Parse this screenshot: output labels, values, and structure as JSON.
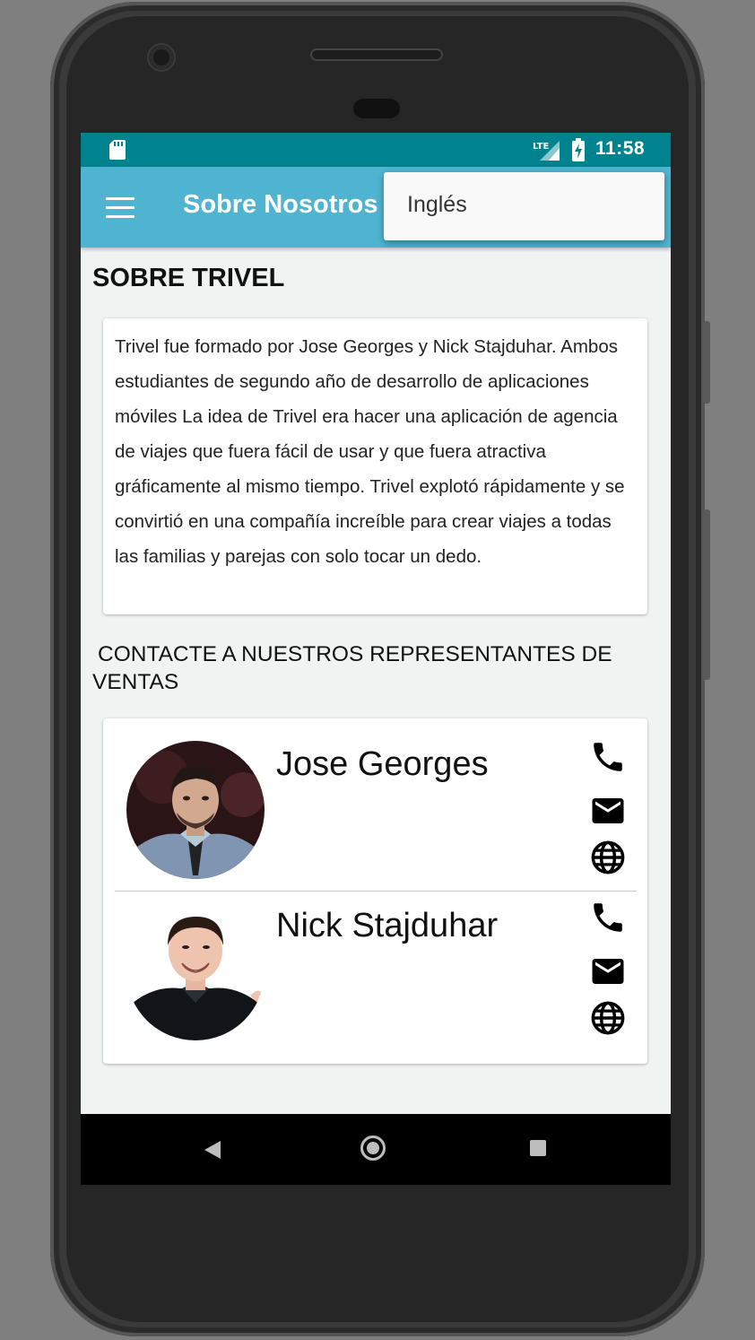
{
  "status_bar": {
    "time": "11:58",
    "network": "LTE",
    "icons": [
      "sd-card-icon",
      "lte-signal-icon",
      "battery-charging-icon"
    ]
  },
  "app_bar": {
    "title": "Sobre Nosotros",
    "menu_icon": "hamburger-menu-icon"
  },
  "dropdown_menu": {
    "items": [
      {
        "label": "Inglés"
      }
    ]
  },
  "about": {
    "heading": "SOBRE TRIVEL",
    "body": "Trivel fue formado por Jose Georges y Nick Stajduhar. Ambos estudiantes de segundo año de desarrollo de aplicaciones móviles La idea de Trivel era hacer una aplicación de agencia de viajes que fuera fácil de usar y que fuera atractiva gráficamente al mismo tiempo. Trivel explotó rápidamente y se convirtió en una compañía increíble para crear viajes a todas las familias y parejas con solo tocar un dedo."
  },
  "contacts": {
    "heading": "CONTACTE A NUESTROS REPRESENTANTES DE VENTAS",
    "representatives": [
      {
        "name": "Jose Georges",
        "actions": [
          "phone-icon",
          "email-icon",
          "globe-icon"
        ]
      },
      {
        "name": "Nick Stajduhar",
        "actions": [
          "phone-icon",
          "email-icon",
          "globe-icon"
        ]
      }
    ]
  },
  "navigation_bar": {
    "buttons": [
      "back-icon",
      "home-icon",
      "recents-icon"
    ]
  },
  "colors": {
    "status_bar": "#00838f",
    "app_bar": "#4eb4cf",
    "screen_background": "#eff4f2",
    "navigation_bar": "#000000"
  }
}
